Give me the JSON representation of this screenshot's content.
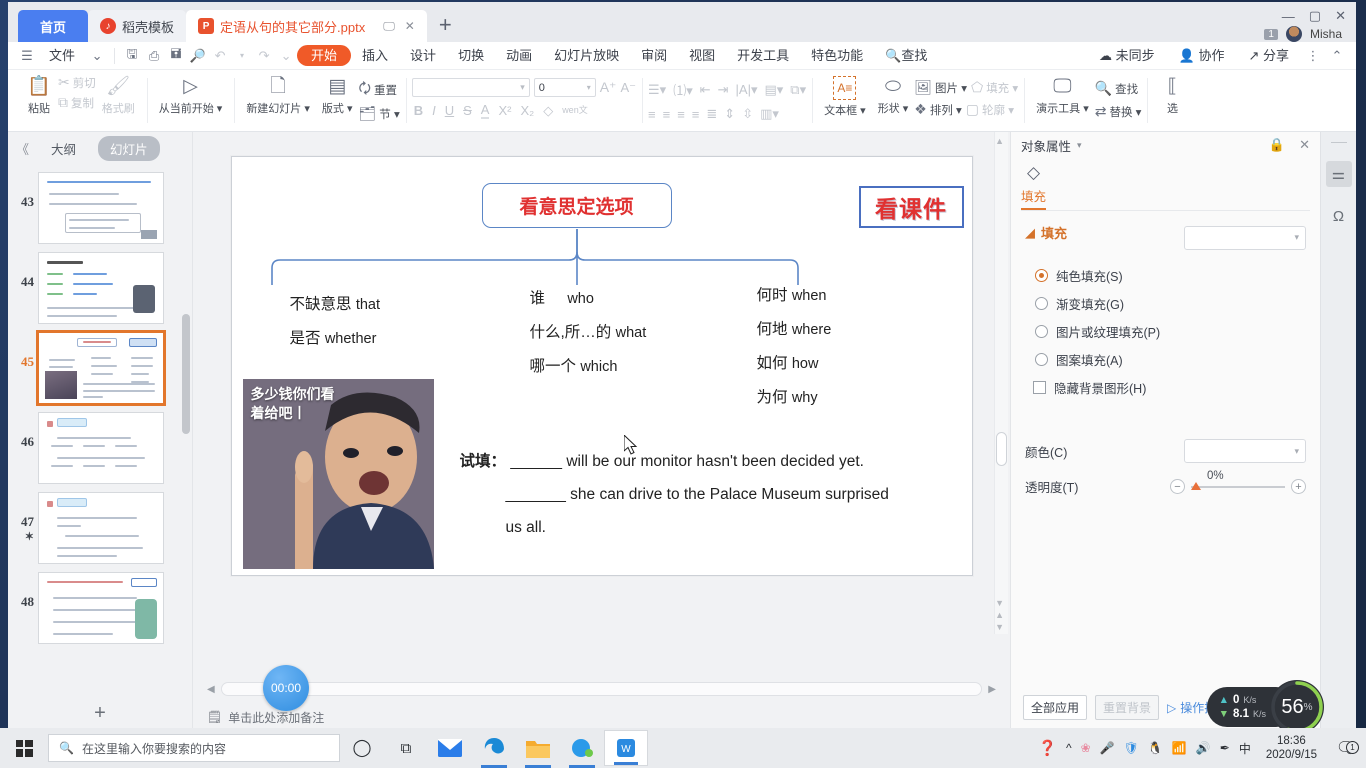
{
  "window": {
    "tabs": [
      {
        "label": "首页",
        "icon": "home-tab",
        "type": "home"
      },
      {
        "label": "稻壳模板",
        "icon": "docer-icon",
        "type": "mid"
      },
      {
        "label": "定语从句的其它部分.pptx",
        "icon": "pptx-icon",
        "type": "active"
      }
    ],
    "new_tab": "+",
    "controls": {
      "minimize": "—",
      "maximize": "▢",
      "close": "✕"
    },
    "account": {
      "badge": "1",
      "name": "Misha"
    }
  },
  "menubar": {
    "file_label": "文件",
    "quick_icons": [
      "save-icon",
      "print-preview-icon",
      "save-as-icon",
      "search-doc-icon",
      "undo-icon",
      "redo-icon",
      "customize-icon"
    ],
    "items": [
      "开始",
      "插入",
      "设计",
      "切换",
      "动画",
      "幻灯片放映",
      "审阅",
      "视图",
      "开发工具",
      "特色功能"
    ],
    "active_item": "开始",
    "find_label": "查找",
    "right_items": [
      "未同步",
      "协作",
      "分享"
    ],
    "more": "⋮",
    "collapse": "⌃"
  },
  "ribbon": {
    "clipboard": {
      "paste": "粘贴",
      "cut": "剪切",
      "copy": "复制",
      "format_painter": "格式刷"
    },
    "present": {
      "from_current": "从当前开始"
    },
    "slides": {
      "new_slide": "新建幻灯片",
      "layout": "版式",
      "reset": "重置",
      "section": "节"
    },
    "font": {
      "family_value": "",
      "size_value": "0",
      "grow": "A",
      "shrink": "A",
      "bold": "B",
      "italic": "I",
      "underline": "U",
      "strikethrough": "S",
      "text_color": "A",
      "superscript": "X²",
      "subscript": "X₂",
      "clear_format": "◇",
      "pinyin": "wen文"
    },
    "insert": {
      "textbox": "文本框",
      "shapes": "形状",
      "picture": "图片",
      "arrange": "排列",
      "fill": "填充",
      "outline": "轮廓"
    },
    "tools": {
      "present_tools": "演示工具",
      "find": "查找",
      "replace": "替换",
      "select": "选"
    }
  },
  "slide_panel": {
    "collapse": "《",
    "outline_tab": "大纲",
    "slides_tab": "幻灯片",
    "active_tab": "幻灯片",
    "thumbnails": [
      {
        "number": "43",
        "selected": false
      },
      {
        "number": "44",
        "selected": false
      },
      {
        "number": "45",
        "selected": true
      },
      {
        "number": "46",
        "selected": false
      },
      {
        "number": "47",
        "selected": false,
        "starred": true
      },
      {
        "number": "48",
        "selected": false
      }
    ],
    "add_slide": "+"
  },
  "slide": {
    "root_title": "看意思定选项",
    "course_badge": "看课件",
    "columns": [
      {
        "name": "column-1",
        "rows": [
          {
            "cn": "不缺意思",
            "en": "that"
          },
          {
            "cn": "是否",
            "en": "whether"
          }
        ]
      },
      {
        "name": "column-2",
        "rows": [
          {
            "cn": "谁",
            "en": "who"
          },
          {
            "cn": "什么,所…的",
            "en": "what"
          },
          {
            "cn": "哪一个",
            "en": "which"
          }
        ]
      },
      {
        "name": "column-3",
        "rows": [
          {
            "cn": "何时",
            "en": "when"
          },
          {
            "cn": "何地",
            "en": "where"
          },
          {
            "cn": "如何",
            "en": "how"
          },
          {
            "cn": "为何",
            "en": "why"
          }
        ]
      }
    ],
    "image_caption": "多少钱你们看着给吧丨",
    "exercise": {
      "label": "试填：",
      "line1": "______ will be our monitor hasn't been decided yet.",
      "line2": "_______ she can drive to the Palace Museum surprised",
      "line3": "us all."
    }
  },
  "editor_status": {
    "timer": "00:00",
    "notes_placeholder": "单击此处添加备注"
  },
  "right_pane": {
    "title": "对象属性",
    "lock_icon": "lock-icon",
    "close_icon": "close-icon",
    "tab_label": "填充",
    "section_title": "填充",
    "fill_dropdown_value": "",
    "options": [
      {
        "label": "纯色填充(S)",
        "selected": true
      },
      {
        "label": "渐变填充(G)",
        "selected": false
      },
      {
        "label": "图片或纹理填充(P)",
        "selected": false
      },
      {
        "label": "图案填充(A)",
        "selected": false
      }
    ],
    "checkbox": {
      "label": "隐藏背景图形(H)",
      "checked": false
    },
    "color_label": "颜色(C)",
    "color_value": "",
    "transparency_label": "透明度(T)",
    "transparency_value": "0%",
    "footer": {
      "apply_all": "全部应用",
      "reset_bg": "重置背景",
      "tips": "操作技巧"
    }
  },
  "vertical_toolbar": {
    "items": [
      {
        "name": "properties-panel-icon",
        "glyph": "⚌",
        "active": true
      },
      {
        "name": "omega-symbol-icon",
        "glyph": "Ω",
        "active": false
      }
    ]
  },
  "net_monitor": {
    "upload_value": "0",
    "upload_unit": "K/s",
    "download_value": "8.1",
    "download_unit": "K/s",
    "cpu_value": "56",
    "cpu_unit": "%"
  },
  "taskbar": {
    "start": "windows-logo",
    "search_placeholder": "在这里输入你要搜索的内容",
    "icons": [
      "cortana-icon",
      "task-view-icon",
      "mail-icon",
      "edge-icon",
      "file-explorer-icon",
      "qq-icon",
      "wps-icon"
    ],
    "tray_icons": [
      "help-icon",
      "chevron-up-icon",
      "flower-icon",
      "microphone-icon",
      "security-shield-icon",
      "penguin-icon",
      "wifi-icon",
      "volume-icon",
      "pen-icon"
    ],
    "ime": "中",
    "time": "18:36",
    "date": "2020/9/15",
    "notification_count": "1"
  },
  "colors": {
    "accent_orange": "#e2762c",
    "tab_blue": "#4a7ef0",
    "slide_red": "#e03131",
    "connector_blue": "#5b86c6"
  }
}
